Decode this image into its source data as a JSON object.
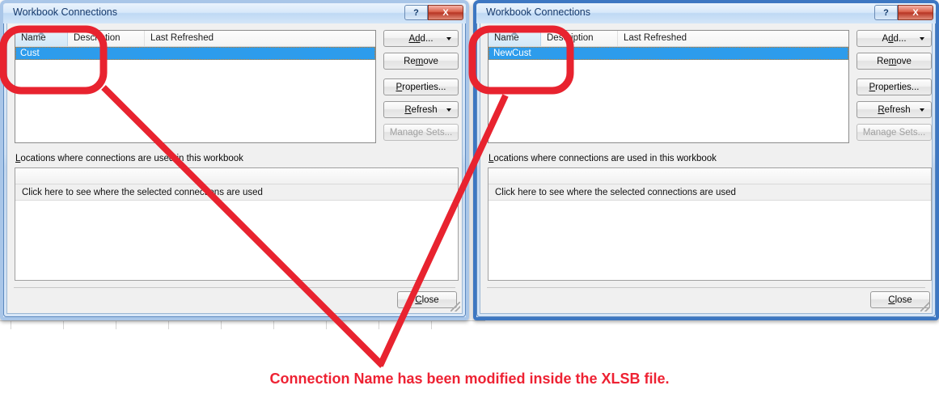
{
  "caption": {
    "text": "Connection Name has been modified inside the XLSB file.",
    "color": "#ee2233"
  },
  "annotation": {
    "color": "#e8232f",
    "highlight_shape": "rounded-rectangle",
    "connector": "v-arrow"
  },
  "dialogs": [
    {
      "id": "before",
      "title": "Workbook Connections",
      "caption_buttons": [
        {
          "name": "help-button",
          "glyph": "?"
        },
        {
          "name": "close-button",
          "glyph": "X"
        }
      ],
      "connections_list": {
        "columns": [
          "Name",
          "Description",
          "Last Refreshed"
        ],
        "sorted_column": "Name",
        "sort_direction": "ascending",
        "rows": [
          {
            "name": "Cust",
            "description": "",
            "last_refreshed": "",
            "selected": true
          }
        ]
      },
      "buttons": [
        {
          "label": "Add...",
          "accesskey": "d",
          "split": true,
          "disabled": false
        },
        {
          "label": "Remove",
          "accesskey": "m",
          "split": false,
          "disabled": false
        },
        {
          "label": "Properties...",
          "accesskey": "P",
          "split": false,
          "disabled": false
        },
        {
          "label": "Refresh",
          "accesskey": "R",
          "split": true,
          "disabled": false
        },
        {
          "label": "Manage Sets...",
          "accesskey": "",
          "split": false,
          "disabled": true
        }
      ],
      "locations_label": "Locations where connections are used in this workbook",
      "locations_row": "Click here to see where the selected connections are used",
      "close_label": "Close",
      "close_accesskey": "C"
    },
    {
      "id": "after",
      "title": "Workbook Connections",
      "caption_buttons": [
        {
          "name": "help-button",
          "glyph": "?"
        },
        {
          "name": "close-button",
          "glyph": "X"
        }
      ],
      "connections_list": {
        "columns": [
          "Name",
          "Description",
          "Last Refreshed"
        ],
        "sorted_column": "Name",
        "sort_direction": "ascending",
        "rows": [
          {
            "name": "NewCust",
            "description": "",
            "last_refreshed": "",
            "selected": true
          }
        ]
      },
      "buttons": [
        {
          "label": "Add...",
          "accesskey": "d",
          "split": true,
          "disabled": false
        },
        {
          "label": "Remove",
          "accesskey": "m",
          "split": false,
          "disabled": false
        },
        {
          "label": "Properties...",
          "accesskey": "P",
          "split": false,
          "disabled": false
        },
        {
          "label": "Refresh",
          "accesskey": "R",
          "split": true,
          "disabled": false
        },
        {
          "label": "Manage Sets...",
          "accesskey": "",
          "split": false,
          "disabled": true
        }
      ],
      "locations_label": "Locations where connections are used in this workbook",
      "locations_row": "Click here to see where the selected connections are used",
      "close_label": "Close",
      "close_accesskey": "C"
    }
  ]
}
